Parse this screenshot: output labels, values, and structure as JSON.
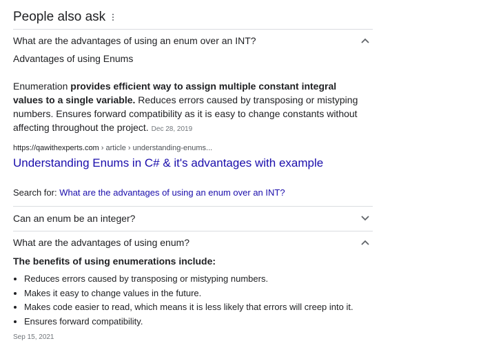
{
  "header": {
    "title": "People also ask",
    "menu_icon": "more-vert-icon"
  },
  "q1": {
    "question": "What are the advantages of using an enum over an INT?",
    "expanded": true,
    "answer_heading": "Advantages of using Enums",
    "answer_lead": "Enumeration ",
    "answer_bold": "provides efficient way to assign multiple constant integral values to a single variable.",
    "answer_rest": " Reduces errors caused by transposing or mistyping numbers. Ensures forward compatibility as it is easy to change constants without affecting throughout the project.",
    "answer_date": "Dec 28, 2019",
    "source_domain": "https://qawithexperts.com",
    "source_crumbs": " › article › understanding-enums...",
    "result_title": "Understanding Enums in C# & it's advantages with example",
    "search_for_label": "Search for: ",
    "search_for_query": "What are the advantages of using an enum over an INT?"
  },
  "q2": {
    "question": "Can an enum be an integer?",
    "expanded": false
  },
  "q3": {
    "question": "What are the advantages of using enum?",
    "expanded": true,
    "answer_heading": "The benefits of using enumerations include:",
    "bullets": [
      "Reduces errors caused by transposing or mistyping numbers.",
      "Makes it easy to change values in the future.",
      "Makes code easier to read, which means it is less likely that errors will creep into it.",
      "Ensures forward compatibility."
    ],
    "cutoff_date": "Sep 15, 2021"
  },
  "colors": {
    "link": "#1a0dab",
    "text": "#202124",
    "divider": "#dadce0",
    "muted": "#70757a"
  }
}
